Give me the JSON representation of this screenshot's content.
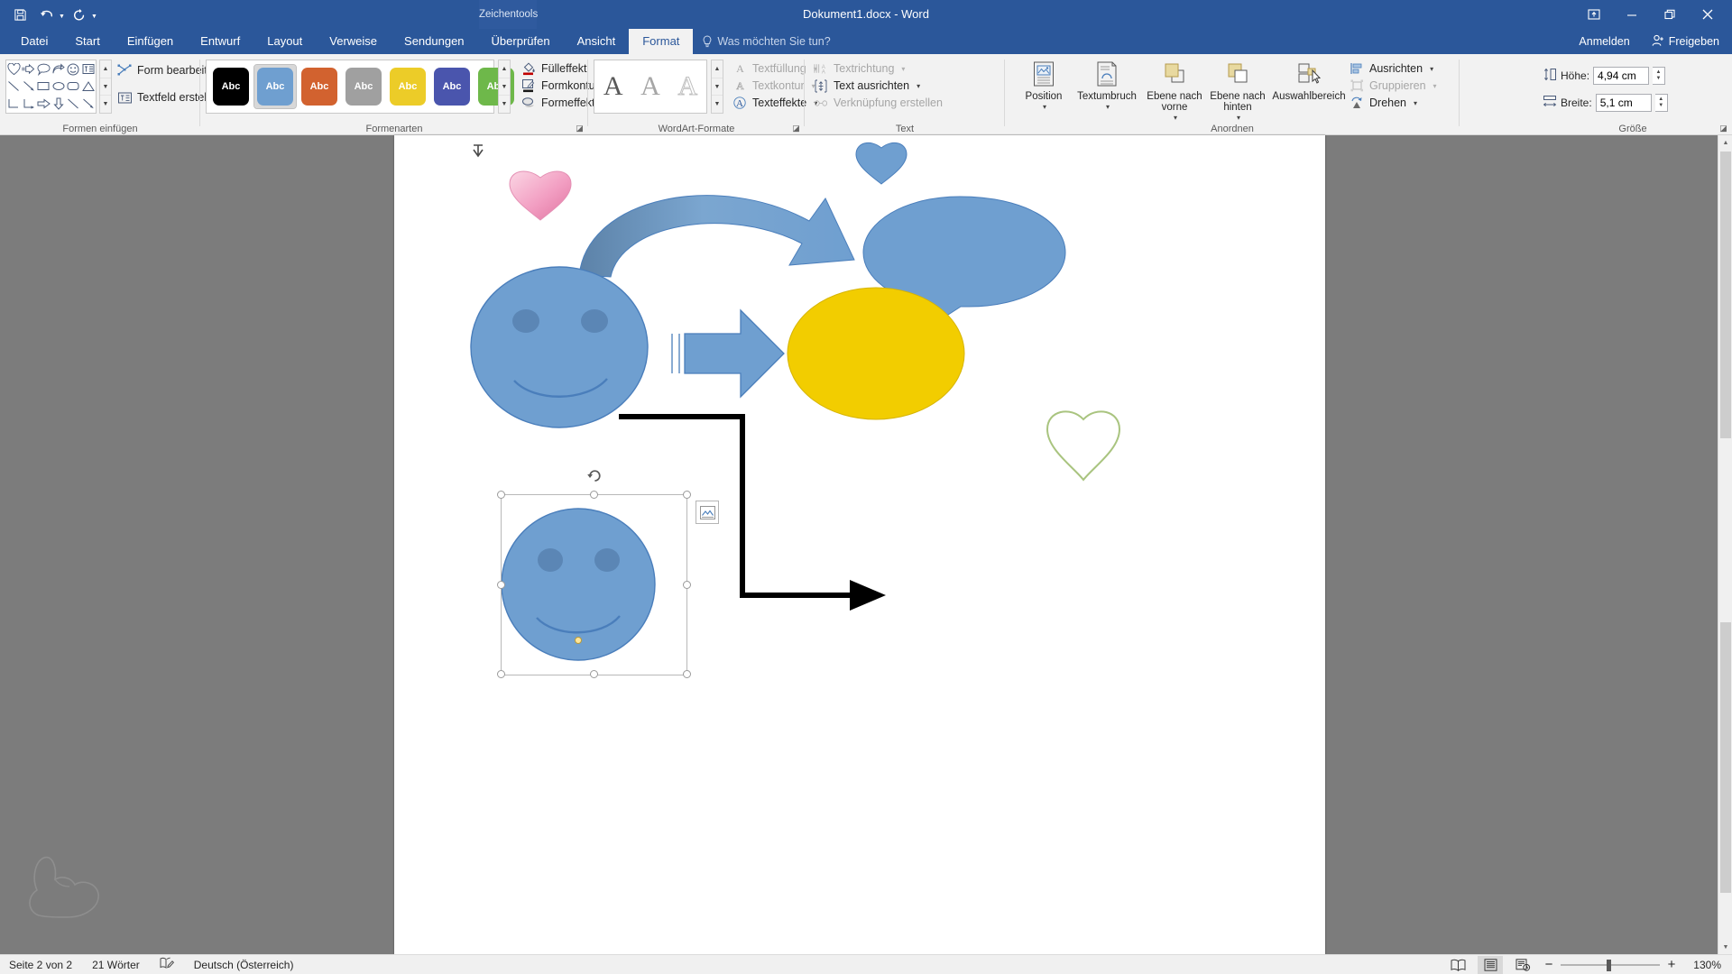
{
  "titlebar": {
    "quick_access": [
      {
        "name": "save-icon",
        "label": "Speichern"
      },
      {
        "name": "undo-icon",
        "label": "Rückgängig"
      },
      {
        "name": "redo-icon",
        "label": "Wiederholen"
      },
      {
        "name": "customize-qat-icon",
        "label": "Symbolleiste anpassen"
      }
    ],
    "contextual_tab_label": "Zeichentools",
    "document_title": "Dokument1.docx - Word",
    "window_controls": [
      {
        "name": "ribbon-display-options-icon",
        "label": "Menüband-Anzeigeoptionen"
      },
      {
        "name": "minimize-icon",
        "label": "Minimieren"
      },
      {
        "name": "restore-icon",
        "label": "Verkleinern"
      },
      {
        "name": "close-icon",
        "label": "Schließen"
      }
    ]
  },
  "tabs": [
    {
      "label": "Datei",
      "active": false
    },
    {
      "label": "Start",
      "active": false
    },
    {
      "label": "Einfügen",
      "active": false
    },
    {
      "label": "Entwurf",
      "active": false
    },
    {
      "label": "Layout",
      "active": false
    },
    {
      "label": "Verweise",
      "active": false
    },
    {
      "label": "Sendungen",
      "active": false
    },
    {
      "label": "Überprüfen",
      "active": false
    },
    {
      "label": "Ansicht",
      "active": false
    },
    {
      "label": "Format",
      "active": true
    }
  ],
  "tellme": {
    "placeholder": "Was möchten Sie tun?",
    "icon": "lightbulb-icon"
  },
  "account": {
    "signin_label": "Anmelden",
    "share_label": "Freigeben",
    "share_icon": "share-person-icon"
  },
  "ribbon": {
    "groups": [
      {
        "name": "insert-shapes",
        "label": "Formen einfügen"
      },
      {
        "name": "shape-styles",
        "label": "Formenarten"
      },
      {
        "name": "wordart-styles",
        "label": "WordArt-Formate"
      },
      {
        "name": "text",
        "label": "Text"
      },
      {
        "name": "arrange",
        "label": "Anordnen"
      },
      {
        "name": "size",
        "label": "Größe"
      }
    ],
    "insert_shapes": {
      "gallery_icons": [
        "heart-shape",
        "striped-right-arrow-shape",
        "speech-bubble-shape",
        "curved-arrow-shape",
        "smiley-face-shape",
        "text-box-shape",
        "line-shape",
        "arrow-line-shape",
        "rectangle-shape",
        "oval-shape",
        "rounded-rectangle-shape",
        "triangle-shape",
        "elbow-connector-shape",
        "elbow-arrow-connector-shape",
        "right-arrow-shape",
        "down-arrow-shape",
        "diagonal-line-shape",
        "diagonal-arrow-shape"
      ],
      "edit_shape_label": "Form bearbeiten",
      "edit_shape_icon": "edit-shape-icon",
      "text_box_label": "Textfeld erstellen",
      "text_box_icon": "textbox-icon"
    },
    "shape_styles": {
      "swatches": [
        {
          "label": "Abc",
          "fill": "#000000",
          "text": "#ffffff",
          "selected": false
        },
        {
          "label": "Abc",
          "fill": "#6f9fd0",
          "text": "#ffffff",
          "selected": true
        },
        {
          "label": "Abc",
          "fill": "#d2622f",
          "text": "#ffffff",
          "selected": false
        },
        {
          "label": "Abc",
          "fill": "#a0a0a0",
          "text": "#ffffff",
          "selected": false
        },
        {
          "label": "Abc",
          "fill": "#eccc28",
          "text": "#ffffff",
          "selected": false
        },
        {
          "label": "Abc",
          "fill": "#4a55ad",
          "text": "#ffffff",
          "selected": false
        },
        {
          "label": "Abc",
          "fill": "#6eb84a",
          "text": "#ffffff",
          "selected": false
        }
      ],
      "fill_label": "Fülleffekt",
      "fill_icon": "fill-bucket-icon",
      "outline_label": "Formkontur",
      "outline_icon": "shape-outline-icon",
      "effects_label": "Formeffekte",
      "effects_icon": "shape-effects-icon"
    },
    "wordart_styles": {
      "samples": [
        {
          "label": "A",
          "style": "filled-dark"
        },
        {
          "label": "A",
          "style": "filled-light"
        },
        {
          "label": "A",
          "style": "outline-light"
        }
      ],
      "text_fill_label": "Textfüllung",
      "text_fill_icon": "text-fill-icon",
      "text_outline_label": "Textkontur",
      "text_outline_icon": "text-outline-icon",
      "text_effects_label": "Texteffekte",
      "text_effects_icon": "text-effects-icon"
    },
    "text_group": {
      "direction_label": "Textrichtung",
      "direction_icon": "text-direction-icon",
      "align_label": "Text ausrichten",
      "align_icon": "align-text-icon",
      "link_label": "Verknüpfung erstellen",
      "link_icon": "create-link-icon"
    },
    "arrange": {
      "position_label": "Position",
      "position_icon": "position-icon",
      "wrap_label": "Textumbruch",
      "wrap_icon": "text-wrap-icon",
      "bring_forward_label": "Ebene nach vorne",
      "bring_forward_icon": "bring-forward-icon",
      "send_backward_label": "Ebene nach hinten",
      "send_backward_icon": "send-backward-icon",
      "selection_pane_label": "Auswahlbereich",
      "selection_pane_icon": "selection-pane-icon",
      "align_label": "Ausrichten",
      "align_icon": "align-objects-icon",
      "group_label": "Gruppieren",
      "group_icon": "group-objects-icon",
      "rotate_label": "Drehen",
      "rotate_icon": "rotate-icon"
    },
    "size": {
      "height_label": "Höhe:",
      "height_value": "4,94 cm",
      "height_icon": "height-icon",
      "width_label": "Breite:",
      "width_value": "5,1 cm",
      "width_icon": "width-icon"
    }
  },
  "canvas": {
    "shapes": [
      {
        "name": "anchor-marker",
        "type": "anchor"
      },
      {
        "name": "pink-heart-shape",
        "type": "heart",
        "fill": "#f5a8c8"
      },
      {
        "name": "blue-heart-shape",
        "type": "heart",
        "fill": "#6f9fd0"
      },
      {
        "name": "curved-arrow-shape",
        "type": "curved-arrow",
        "fill": "#6f9fd0"
      },
      {
        "name": "speech-bubble-shape",
        "type": "speech-bubble",
        "fill": "#6f9fd0"
      },
      {
        "name": "smiley-face-shape-large",
        "type": "smiley",
        "fill": "#6f9fd0"
      },
      {
        "name": "striped-right-arrow-shape",
        "type": "striped-arrow",
        "fill": "#6f9fd0"
      },
      {
        "name": "yellow-oval-shape",
        "type": "oval",
        "fill": "#f2cd00"
      },
      {
        "name": "green-outline-heart-shape",
        "type": "heart-outline",
        "stroke": "#a9c47f"
      },
      {
        "name": "black-elbow-arrow-connector",
        "type": "elbow-arrow",
        "stroke": "#000000"
      },
      {
        "name": "smiley-face-shape-selected",
        "type": "smiley",
        "fill": "#6f9fd0",
        "selected": true
      }
    ],
    "selected_shape_controls": {
      "rotate_handle": "rotate-handle-icon",
      "layout_options_button": "layout-options-icon",
      "adjust_handle": "yellow-adjust-handle"
    }
  },
  "statusbar": {
    "page_info": "Seite 2 von 2",
    "word_count": "21 Wörter",
    "proofing_icon": "proofing-icon",
    "language": "Deutsch (Österreich)",
    "views": [
      {
        "name": "read-mode-view",
        "icon": "read-mode-icon",
        "active": false
      },
      {
        "name": "print-layout-view",
        "icon": "print-layout-icon",
        "active": true
      },
      {
        "name": "web-layout-view",
        "icon": "web-layout-icon",
        "active": false
      }
    ],
    "zoom_out_label": "−",
    "zoom_in_label": "+",
    "zoom_level": "130%"
  }
}
